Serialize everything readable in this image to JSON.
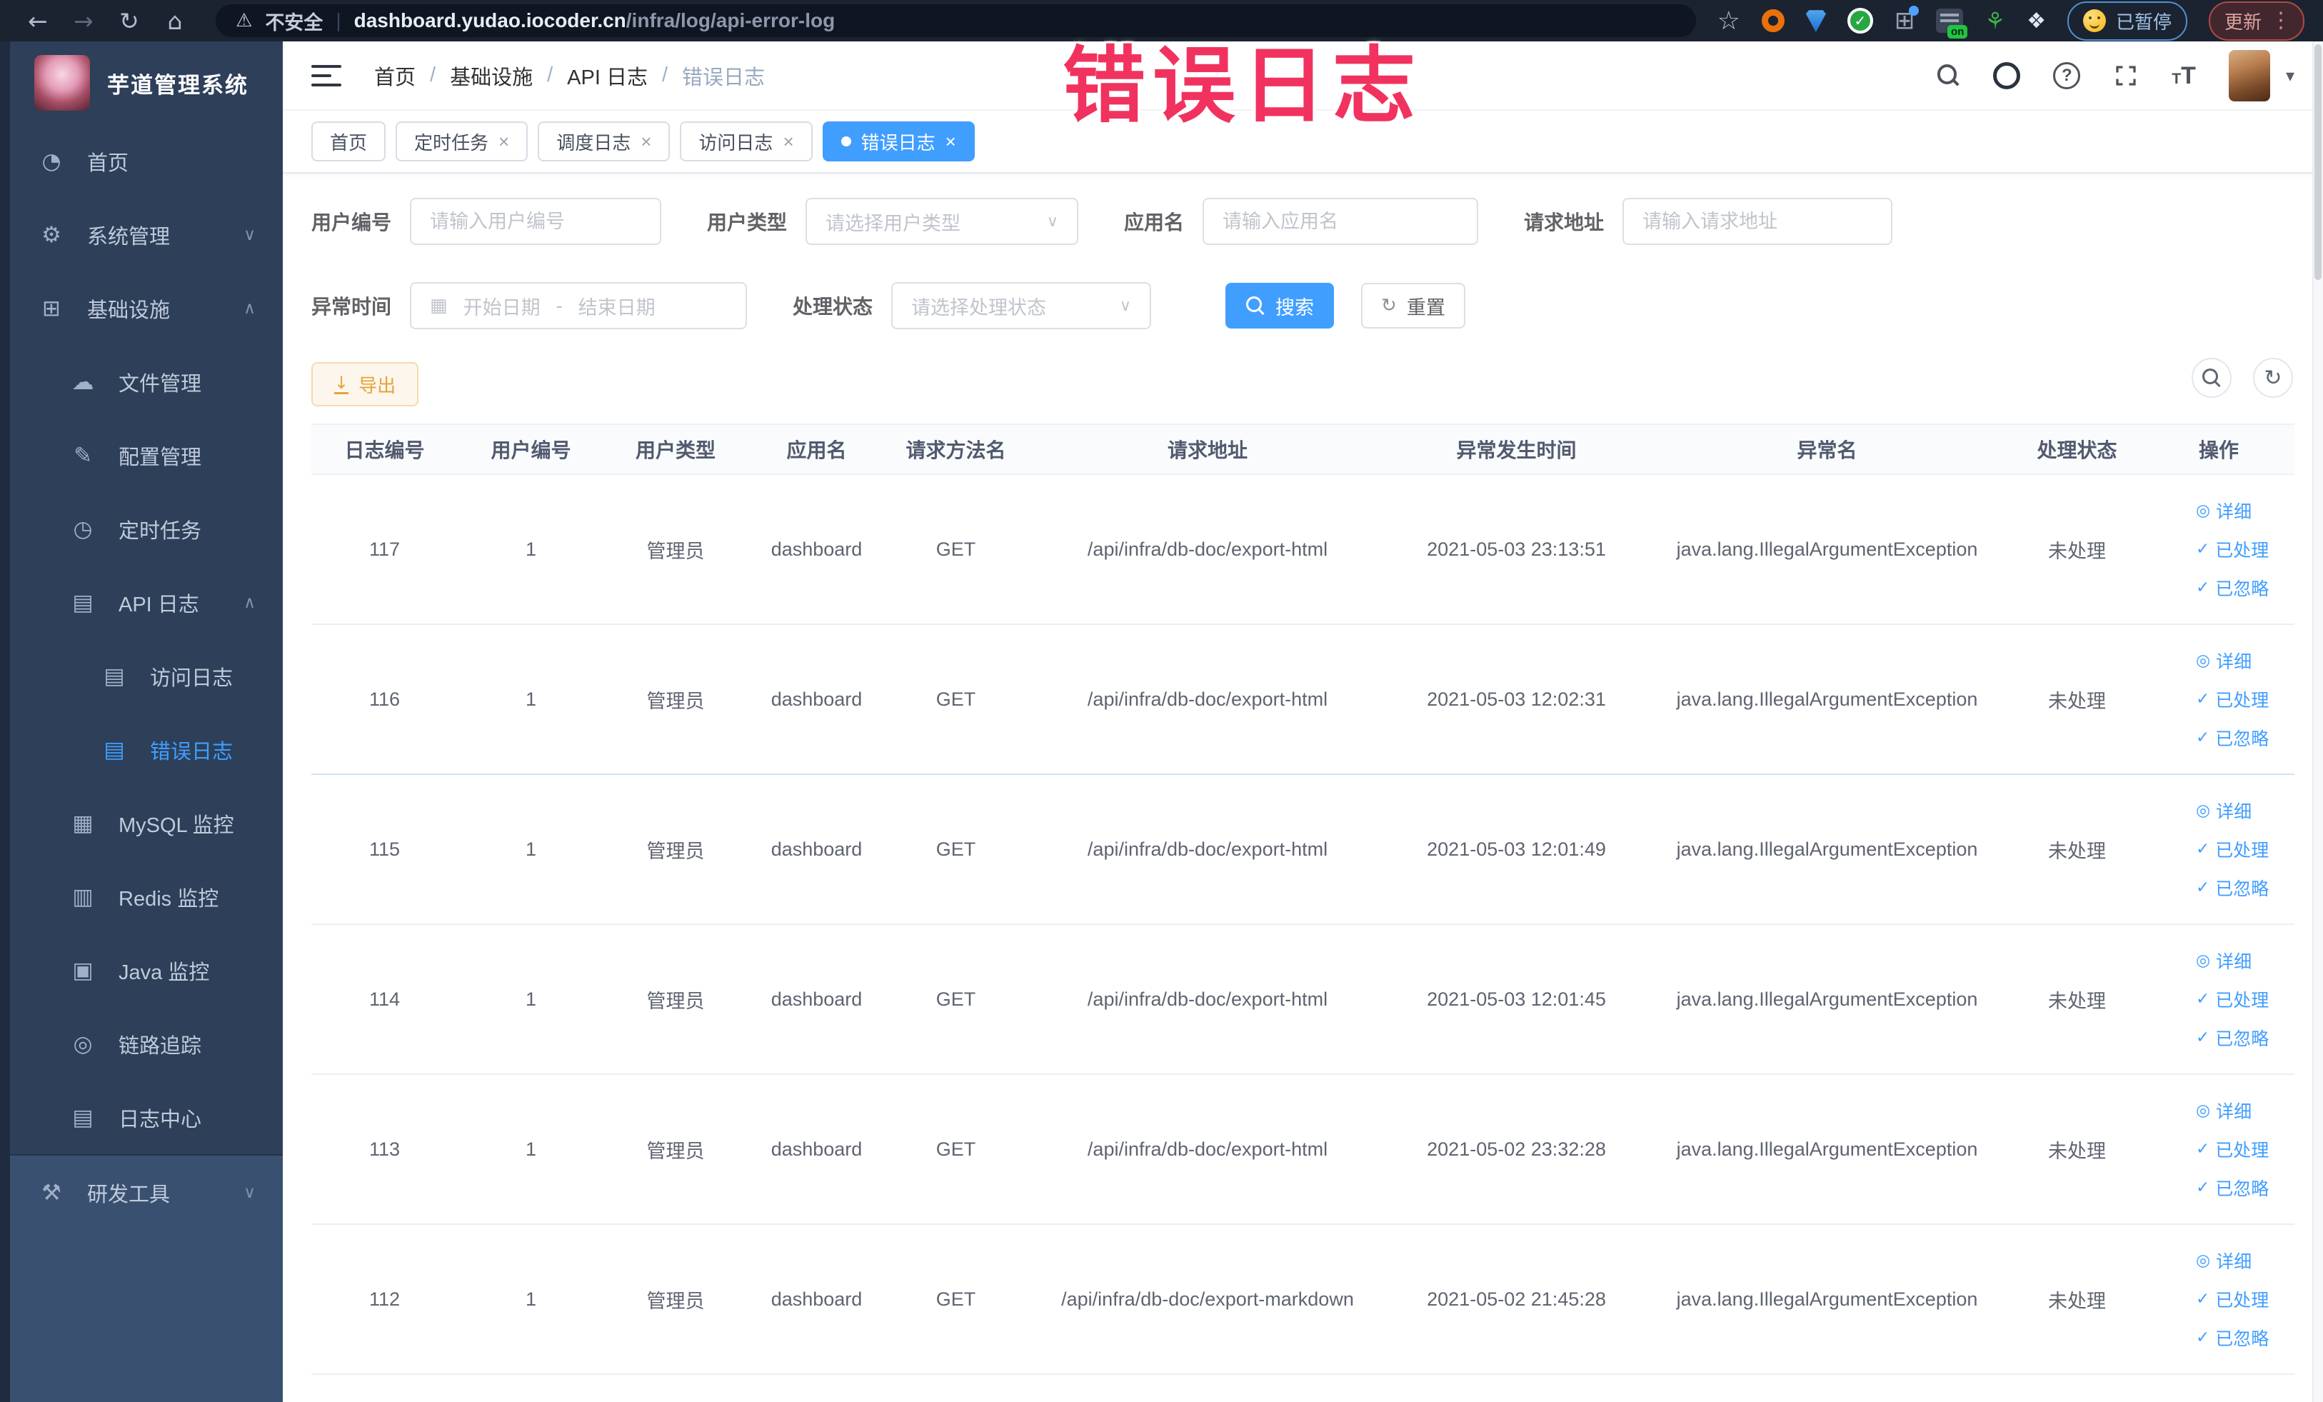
{
  "browser": {
    "security_label": "不安全",
    "url_host": "dashboard.yudao.iocoder.cn",
    "url_path": "/infra/log/api-error-log",
    "paused_badge": "已暂停",
    "update_badge": "更新"
  },
  "overlay": {
    "text": "错误日志"
  },
  "sidebar": {
    "title": "芋道管理系统",
    "items": [
      {
        "name": "home",
        "label": "首页",
        "icon": "dashboard-icon",
        "glyph": "◔",
        "level": 0,
        "arrow": "",
        "active": false
      },
      {
        "name": "system-manage",
        "label": "系统管理",
        "icon": "gear-icon",
        "glyph": "⚙",
        "level": 0,
        "arrow": "down",
        "active": false
      },
      {
        "name": "infrastructure",
        "label": "基础设施",
        "icon": "monitor-icon",
        "glyph": "⊞",
        "level": 0,
        "arrow": "up",
        "active": false
      },
      {
        "name": "file-manage",
        "label": "文件管理",
        "icon": "cloud-upload-icon",
        "glyph": "☁",
        "level": 1,
        "arrow": "",
        "active": false
      },
      {
        "name": "config-manage",
        "label": "配置管理",
        "icon": "edit-icon",
        "glyph": "✎",
        "level": 1,
        "arrow": "",
        "active": false
      },
      {
        "name": "scheduled-task",
        "label": "定时任务",
        "icon": "clock-icon",
        "glyph": "◷",
        "level": 1,
        "arrow": "",
        "active": false
      },
      {
        "name": "api-log",
        "label": "API 日志",
        "icon": "log-file-icon",
        "glyph": "▤",
        "level": 1,
        "arrow": "up",
        "active": false
      },
      {
        "name": "access-log",
        "label": "访问日志",
        "icon": "log-file-icon",
        "glyph": "▤",
        "level": 2,
        "arrow": "",
        "active": false
      },
      {
        "name": "error-log",
        "label": "错误日志",
        "icon": "log-file-icon",
        "glyph": "▤",
        "level": 2,
        "arrow": "",
        "active": true
      },
      {
        "name": "mysql-monitor",
        "label": "MySQL 监控",
        "icon": "database-icon",
        "glyph": "▦",
        "level": 1,
        "arrow": "",
        "active": false
      },
      {
        "name": "redis-monitor",
        "label": "Redis 监控",
        "icon": "database-stack-icon",
        "glyph": "▥",
        "level": 1,
        "arrow": "",
        "active": false
      },
      {
        "name": "java-monitor",
        "label": "Java 监控",
        "icon": "java-monitor-icon",
        "glyph": "▣",
        "level": 1,
        "arrow": "",
        "active": false
      },
      {
        "name": "trace",
        "label": "链路追踪",
        "icon": "eye-icon",
        "glyph": "◎",
        "level": 1,
        "arrow": "",
        "active": false
      },
      {
        "name": "log-center",
        "label": "日志中心",
        "icon": "log-file-icon",
        "glyph": "▤",
        "level": 1,
        "arrow": "",
        "active": false
      }
    ],
    "lower_items": [
      {
        "name": "dev-tools",
        "label": "研发工具",
        "icon": "tools-icon",
        "glyph": "⚒",
        "level": 0,
        "arrow": "down",
        "active": false
      }
    ]
  },
  "header": {
    "breadcrumb": [
      "首页",
      "基础设施",
      "API 日志",
      "错误日志"
    ]
  },
  "tabs": [
    {
      "name": "home",
      "label": "首页",
      "closable": false,
      "active": false
    },
    {
      "name": "scheduled-task",
      "label": "定时任务",
      "closable": true,
      "active": false
    },
    {
      "name": "schedule-log",
      "label": "调度日志",
      "closable": true,
      "active": false
    },
    {
      "name": "access-log",
      "label": "访问日志",
      "closable": true,
      "active": false
    },
    {
      "name": "error-log",
      "label": "错误日志",
      "closable": true,
      "active": true
    }
  ],
  "filters": {
    "user_id": {
      "label": "用户编号",
      "placeholder": "请输入用户编号"
    },
    "user_type": {
      "label": "用户类型",
      "placeholder": "请选择用户类型"
    },
    "app_name": {
      "label": "应用名",
      "placeholder": "请输入应用名"
    },
    "request_url": {
      "label": "请求地址",
      "placeholder": "请输入请求地址"
    },
    "exception_time": {
      "label": "异常时间",
      "start_placeholder": "开始日期",
      "separator": "-",
      "end_placeholder": "结束日期"
    },
    "process_status": {
      "label": "处理状态",
      "placeholder": "请选择处理状态"
    },
    "search_label": "搜索",
    "reset_label": "重置"
  },
  "toolbar": {
    "export_label": "导出"
  },
  "table": {
    "columns": [
      "日志编号",
      "用户编号",
      "用户类型",
      "应用名",
      "请求方法名",
      "请求地址",
      "异常发生时间",
      "异常名",
      "处理状态",
      "操作"
    ],
    "row_actions": [
      {
        "label": "详细",
        "name": "detail",
        "icon": "eye-icon",
        "glyph": "◎"
      },
      {
        "label": "已处理",
        "name": "processed",
        "icon": "check-icon",
        "glyph": "✓"
      },
      {
        "label": "已忽略",
        "name": "ignored",
        "icon": "check-icon",
        "glyph": "✓"
      }
    ],
    "rows": [
      {
        "id": "117",
        "user_id": "1",
        "user_type": "管理员",
        "app": "dashboard",
        "method": "GET",
        "url": "/api/infra/db-doc/export-html",
        "time": "2021-05-03 23:13:51",
        "exception": "java.lang.IllegalArgumentException",
        "status": "未处理"
      },
      {
        "id": "116",
        "user_id": "1",
        "user_type": "管理员",
        "app": "dashboard",
        "method": "GET",
        "url": "/api/infra/db-doc/export-html",
        "time": "2021-05-03 12:02:31",
        "exception": "java.lang.IllegalArgumentException",
        "status": "未处理"
      },
      {
        "id": "115",
        "user_id": "1",
        "user_type": "管理员",
        "app": "dashboard",
        "method": "GET",
        "url": "/api/infra/db-doc/export-html",
        "time": "2021-05-03 12:01:49",
        "exception": "java.lang.IllegalArgumentException",
        "status": "未处理"
      },
      {
        "id": "114",
        "user_id": "1",
        "user_type": "管理员",
        "app": "dashboard",
        "method": "GET",
        "url": "/api/infra/db-doc/export-html",
        "time": "2021-05-03 12:01:45",
        "exception": "java.lang.IllegalArgumentException",
        "status": "未处理"
      },
      {
        "id": "113",
        "user_id": "1",
        "user_type": "管理员",
        "app": "dashboard",
        "method": "GET",
        "url": "/api/infra/db-doc/export-html",
        "time": "2021-05-02 23:32:28",
        "exception": "java.lang.IllegalArgumentException",
        "status": "未处理"
      },
      {
        "id": "112",
        "user_id": "1",
        "user_type": "管理员",
        "app": "dashboard",
        "method": "GET",
        "url": "/api/infra/db-doc/export-markdown",
        "time": "2021-05-02 21:45:28",
        "exception": "java.lang.IllegalArgumentException",
        "status": "未处理"
      }
    ]
  }
}
